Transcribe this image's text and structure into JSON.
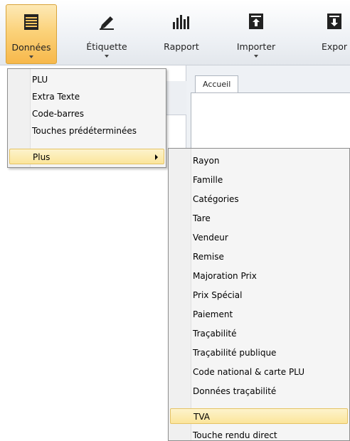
{
  "ribbon": {
    "buttons": [
      {
        "label": "Données",
        "icon": "table-icon",
        "active": true
      },
      {
        "label": "Étiquette",
        "icon": "pencil-icon"
      },
      {
        "label": "Rapport",
        "icon": "bar-chart-icon"
      },
      {
        "label": "Importer",
        "icon": "import-icon"
      },
      {
        "label": "Expor",
        "icon": "export-icon"
      }
    ]
  },
  "tabs": {
    "accueil": "Accueil"
  },
  "menu_donnees": {
    "items": [
      "PLU",
      "Extra Texte",
      "Code-barres",
      "Touches prédéterminées",
      "Plus"
    ]
  },
  "menu_plus": {
    "items": [
      "Rayon",
      "Famille",
      "Catégories",
      "Tare",
      "Vendeur",
      "Remise",
      "Majoration Prix",
      "Prix Spécial",
      "Paiement",
      "Traçabilité",
      "Traçabilité publique",
      "Code national & carte PLU",
      "Données traçabilité",
      "TVA",
      "Touche rendu direct"
    ]
  },
  "colors": {
    "highlight": "#fbe59b",
    "active_tab": "#f7b84b"
  }
}
